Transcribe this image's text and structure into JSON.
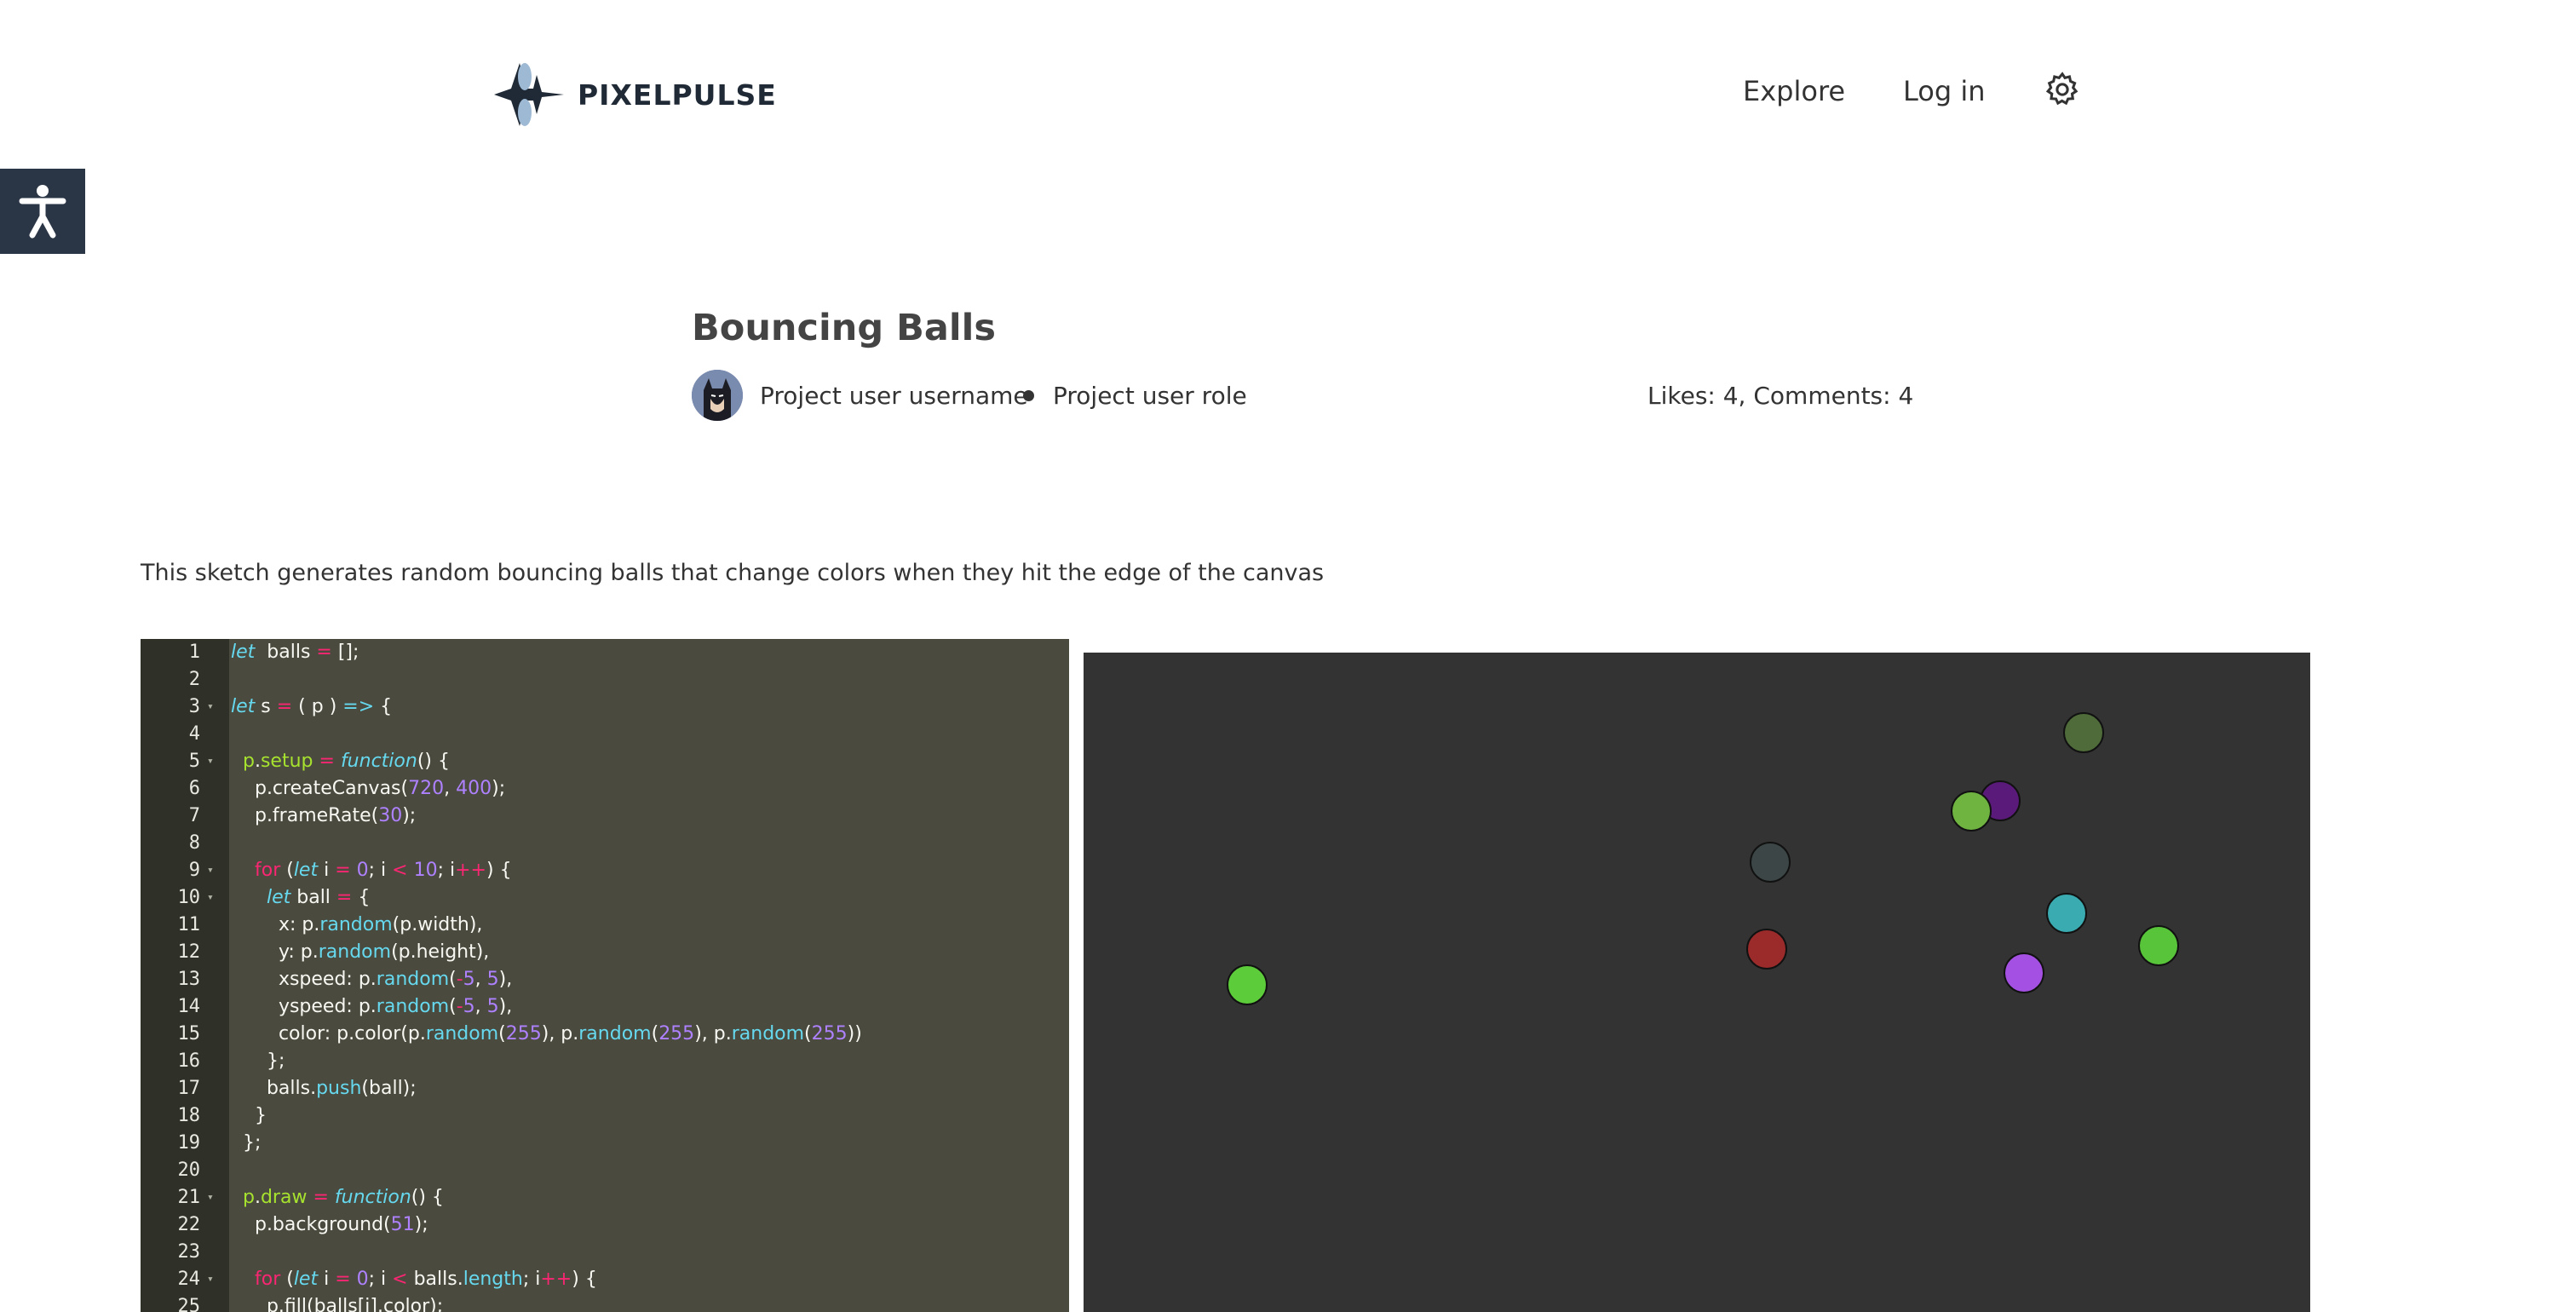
{
  "brand": {
    "name": "PIXELPULSE"
  },
  "nav": {
    "explore": "Explore",
    "login": "Log in",
    "settings_icon": "gear-icon"
  },
  "accessibility": {
    "icon": "accessibility-icon",
    "color": "#2a3545"
  },
  "project": {
    "title": "Bouncing Balls",
    "username": "Project user username",
    "role": "Project user role",
    "stats": "Likes: 4, Comments: 4",
    "description": "This sketch generates random bouncing balls that change colors when they hit the edge of the canvas"
  },
  "editor": {
    "lines": [
      {
        "n": "1",
        "fold": false,
        "segs": [
          [
            "kw",
            "let"
          ],
          [
            "",
            "  balls "
          ],
          [
            "op",
            "="
          ],
          [
            "",
            " [];"
          ]
        ]
      },
      {
        "n": "2",
        "fold": false,
        "segs": []
      },
      {
        "n": "3",
        "fold": true,
        "segs": [
          [
            "kw",
            "let"
          ],
          [
            "",
            " s "
          ],
          [
            "op",
            "="
          ],
          [
            "",
            " ( p ) "
          ],
          [
            "kw",
            "=>"
          ],
          [
            "",
            " {"
          ]
        ]
      },
      {
        "n": "4",
        "fold": false,
        "segs": []
      },
      {
        "n": "5",
        "fold": true,
        "segs": [
          [
            "",
            "  "
          ],
          [
            "fn",
            "p"
          ],
          [
            "",
            "."
          ],
          [
            "fn",
            "setup"
          ],
          [
            "",
            " "
          ],
          [
            "op",
            "="
          ],
          [
            "",
            " "
          ],
          [
            "kw",
            "function"
          ],
          [
            "",
            "() {"
          ]
        ]
      },
      {
        "n": "6",
        "fold": false,
        "segs": [
          [
            "",
            "    p.createCanvas("
          ],
          [
            "num",
            "720"
          ],
          [
            "",
            ", "
          ],
          [
            "num",
            "400"
          ],
          [
            "",
            ");"
          ]
        ]
      },
      {
        "n": "7",
        "fold": false,
        "segs": [
          [
            "",
            "    p.frameRate("
          ],
          [
            "num",
            "30"
          ],
          [
            "",
            ");"
          ]
        ]
      },
      {
        "n": "8",
        "fold": false,
        "segs": []
      },
      {
        "n": "9",
        "fold": true,
        "segs": [
          [
            "",
            "    "
          ],
          [
            "op",
            "for"
          ],
          [
            "",
            " ("
          ],
          [
            "kw",
            "let"
          ],
          [
            "",
            " i "
          ],
          [
            "op",
            "="
          ],
          [
            "",
            " "
          ],
          [
            "num",
            "0"
          ],
          [
            "",
            "; i "
          ],
          [
            "op",
            "<"
          ],
          [
            "",
            " "
          ],
          [
            "num",
            "10"
          ],
          [
            "",
            "; i"
          ],
          [
            "op",
            "++"
          ],
          [
            "",
            ") {"
          ]
        ]
      },
      {
        "n": "10",
        "fold": true,
        "segs": [
          [
            "",
            "      "
          ],
          [
            "kw",
            "let"
          ],
          [
            "",
            " ball "
          ],
          [
            "op",
            "="
          ],
          [
            "",
            " {"
          ]
        ]
      },
      {
        "n": "11",
        "fold": false,
        "segs": [
          [
            "",
            "        x: p."
          ],
          [
            "mth",
            "random"
          ],
          [
            "",
            "(p.width),"
          ]
        ]
      },
      {
        "n": "12",
        "fold": false,
        "segs": [
          [
            "",
            "        y: p."
          ],
          [
            "mth",
            "random"
          ],
          [
            "",
            "(p.height),"
          ]
        ]
      },
      {
        "n": "13",
        "fold": false,
        "segs": [
          [
            "",
            "        xspeed: p."
          ],
          [
            "mth",
            "random"
          ],
          [
            "",
            "("
          ],
          [
            "op",
            "-"
          ],
          [
            "num",
            "5"
          ],
          [
            "",
            ", "
          ],
          [
            "num",
            "5"
          ],
          [
            "",
            "),"
          ]
        ]
      },
      {
        "n": "14",
        "fold": false,
        "segs": [
          [
            "",
            "        yspeed: p."
          ],
          [
            "mth",
            "random"
          ],
          [
            "",
            "("
          ],
          [
            "op",
            "-"
          ],
          [
            "num",
            "5"
          ],
          [
            "",
            ", "
          ],
          [
            "num",
            "5"
          ],
          [
            "",
            "),"
          ]
        ]
      },
      {
        "n": "15",
        "fold": false,
        "segs": [
          [
            "",
            "        color: p.color(p."
          ],
          [
            "mth",
            "random"
          ],
          [
            "",
            "("
          ],
          [
            "num",
            "255"
          ],
          [
            "",
            "), p."
          ],
          [
            "mth",
            "random"
          ],
          [
            "",
            "("
          ],
          [
            "num",
            "255"
          ],
          [
            "",
            "), p."
          ],
          [
            "mth",
            "random"
          ],
          [
            "",
            "("
          ],
          [
            "num",
            "255"
          ],
          [
            "",
            "))"
          ]
        ]
      },
      {
        "n": "16",
        "fold": false,
        "segs": [
          [
            "",
            "      };"
          ]
        ]
      },
      {
        "n": "17",
        "fold": false,
        "segs": [
          [
            "",
            "      balls."
          ],
          [
            "mth",
            "push"
          ],
          [
            "",
            "(ball);"
          ]
        ]
      },
      {
        "n": "18",
        "fold": false,
        "segs": [
          [
            "",
            "    }"
          ]
        ]
      },
      {
        "n": "19",
        "fold": false,
        "segs": [
          [
            "",
            "  };"
          ]
        ]
      },
      {
        "n": "20",
        "fold": false,
        "segs": []
      },
      {
        "n": "21",
        "fold": true,
        "segs": [
          [
            "",
            "  "
          ],
          [
            "fn",
            "p"
          ],
          [
            "",
            "."
          ],
          [
            "fn",
            "draw"
          ],
          [
            "",
            " "
          ],
          [
            "op",
            "="
          ],
          [
            "",
            " "
          ],
          [
            "kw",
            "function"
          ],
          [
            "",
            "() {"
          ]
        ]
      },
      {
        "n": "22",
        "fold": false,
        "segs": [
          [
            "",
            "    p.background("
          ],
          [
            "num",
            "51"
          ],
          [
            "",
            ");"
          ]
        ]
      },
      {
        "n": "23",
        "fold": false,
        "segs": []
      },
      {
        "n": "24",
        "fold": true,
        "segs": [
          [
            "",
            "    "
          ],
          [
            "op",
            "for"
          ],
          [
            "",
            " ("
          ],
          [
            "kw",
            "let"
          ],
          [
            "",
            " i "
          ],
          [
            "op",
            "="
          ],
          [
            "",
            " "
          ],
          [
            "num",
            "0"
          ],
          [
            "",
            "; i "
          ],
          [
            "op",
            "<"
          ],
          [
            "",
            " balls."
          ],
          [
            "mth",
            "length"
          ],
          [
            "",
            "; i"
          ],
          [
            "op",
            "++"
          ],
          [
            "",
            ") {"
          ]
        ]
      },
      {
        "n": "25",
        "fold": false,
        "segs": [
          [
            "",
            "      p.fill(balls[i].color);"
          ]
        ]
      }
    ]
  },
  "sketch": {
    "background": "#333333",
    "balls": [
      {
        "color": "#4f6b3a"
      },
      {
        "color": "#5a1a7a"
      },
      {
        "color": "#6fb441"
      },
      {
        "color": "#3c4646"
      },
      {
        "color": "#3aabb0"
      },
      {
        "color": "#9b2a2a"
      },
      {
        "color": "#58c43a"
      },
      {
        "color": "#a450e2"
      },
      {
        "color": "#5dcc3a"
      },
      {
        "color": "#6a1a8a"
      }
    ]
  }
}
